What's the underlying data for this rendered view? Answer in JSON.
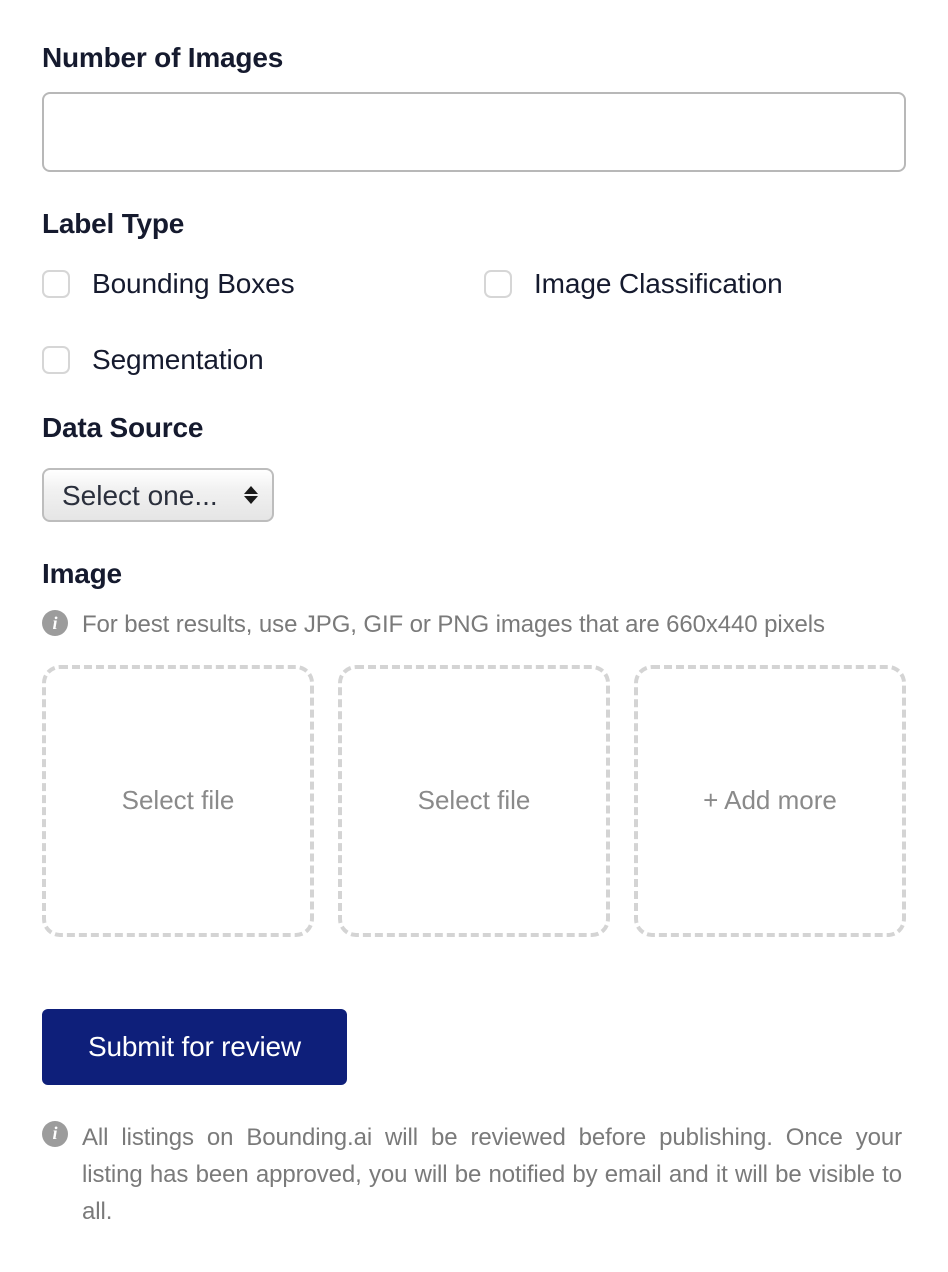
{
  "number_of_images": {
    "label": "Number of Images",
    "value": ""
  },
  "label_type": {
    "label": "Label Type",
    "options": {
      "bounding_boxes": "Bounding Boxes",
      "image_classification": "Image Classification",
      "segmentation": "Segmentation"
    }
  },
  "data_source": {
    "label": "Data Source",
    "selected": "Select one..."
  },
  "image_upload": {
    "label": "Image",
    "hint": "For best results, use JPG, GIF or PNG images that are 660x440 pixels",
    "slots": {
      "select_file": "Select file",
      "add_more": "+ Add more"
    }
  },
  "submit": {
    "label": "Submit for review",
    "disclaimer": "All listings on Bounding.ai will be reviewed before publishing. Once your listing has been approved, you will be notified by email and it will be visible to all."
  }
}
